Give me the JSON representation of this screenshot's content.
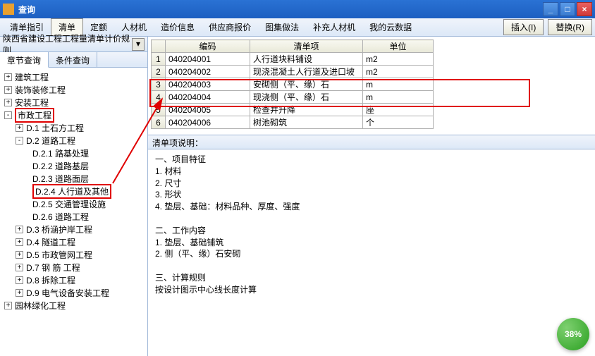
{
  "window": {
    "title": "查询"
  },
  "winbtns": {
    "min": "_",
    "max": "□",
    "close": "×"
  },
  "menu": {
    "items": [
      "清单指引",
      "清单",
      "定额",
      "人材机",
      "造价信息",
      "供应商报价",
      "图集做法",
      "补充人材机",
      "我的云数据"
    ],
    "insert": "插入(I)",
    "replace": "替换(R)"
  },
  "rule": {
    "label": "陕西省建设工程工程量清单计价规则"
  },
  "subtabs": {
    "chapter": "章节查询",
    "condition": "条件查询"
  },
  "tree": {
    "n0": "建筑工程",
    "n1": "装饰装修工程",
    "n2": "安装工程",
    "n3": "市政工程",
    "n3_0": "D.1  土石方工程",
    "n3_1": "D.2  道路工程",
    "n3_1_0": "D.2.1  路基处理",
    "n3_1_1": "D.2.2  道路基层",
    "n3_1_2": "D.2.3  道路面层",
    "n3_1_3": "D.2.4  人行道及其他",
    "n3_1_4": "D.2.5  交通管理设施",
    "n3_1_5": "D.2.6  道路工程",
    "n3_2": "D.3  桥涵护岸工程",
    "n3_3": "D.4  隧道工程",
    "n3_4": "D.5  市政管网工程",
    "n3_5": "D.7  钢 筋 工程",
    "n3_6": "D.8  拆除工程",
    "n3_7": "D.9  电气设备安装工程",
    "n4": "园林绿化工程"
  },
  "grid": {
    "headers": {
      "code": "编码",
      "item": "清单项",
      "unit": "单位"
    },
    "rows": [
      {
        "n": "1",
        "code": "040204001",
        "item": "人行道块料铺设",
        "unit": "m2"
      },
      {
        "n": "2",
        "code": "040204002",
        "item": "现浇混凝土人行道及进口坡",
        "unit": "m2"
      },
      {
        "n": "3",
        "code": "040204003",
        "item": "安砌侧（平、缘）石",
        "unit": "m"
      },
      {
        "n": "4",
        "code": "040204004",
        "item": "现浇侧（平、缘）石",
        "unit": "m"
      },
      {
        "n": "5",
        "code": "040204005",
        "item": "检查井升降",
        "unit": "座"
      },
      {
        "n": "6",
        "code": "040204006",
        "item": "树池砌筑",
        "unit": "个"
      }
    ]
  },
  "desc": {
    "header": "清单项说明：",
    "body": "一、项目特征\n1. 材料\n2. 尺寸\n3. 形状\n4. 垫层、基础：材料品种、厚度、强度\n\n二、工作内容\n1. 垫层、基础铺筑\n2. 侧（平、缘）石安砌\n\n三、计算规则\n 按设计图示中心线长度计算"
  },
  "badge": {
    "value": "38%"
  }
}
